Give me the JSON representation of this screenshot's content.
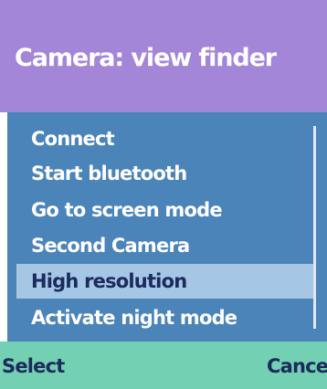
{
  "window": {
    "title": "Camera: view finder"
  },
  "menu": {
    "items": [
      {
        "label": "Connect",
        "highlighted": false
      },
      {
        "label": "Start bluetooth",
        "highlighted": false
      },
      {
        "label": "Go to screen mode",
        "highlighted": false
      },
      {
        "label": "Second Camera",
        "highlighted": false
      },
      {
        "label": "High resolution",
        "highlighted": true
      },
      {
        "label": "Activate night mode",
        "highlighted": false
      }
    ]
  },
  "softkeys": {
    "left_label": "Select",
    "right_label": "Cancel"
  },
  "colors": {
    "title_bar": "#a486d8",
    "menu_background": "#4a84b8",
    "highlight": "#a6c6e6",
    "softkey_bar": "#74d0b2",
    "highlight_text": "#1a2b5c"
  }
}
